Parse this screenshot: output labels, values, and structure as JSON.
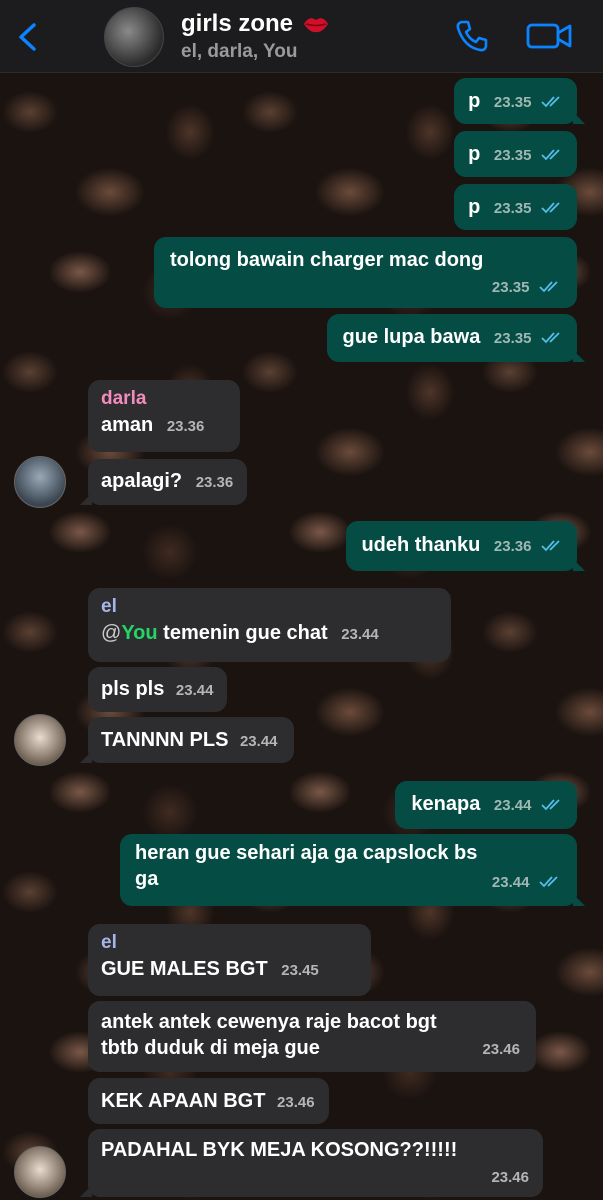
{
  "header": {
    "title": "girls zone",
    "subtitle": "el, darla, You",
    "icons": {
      "back": "chevron-left-icon",
      "lips": "lips-emoji-icon",
      "call": "phone-icon",
      "video": "video-camera-icon"
    },
    "accent_color": "#0a84ff"
  },
  "colors": {
    "outgoing": "#054d44",
    "incoming": "#2d2d2f",
    "darla_name": "#f38bbd",
    "el_name": "#a9b4e6",
    "mention": "#25d366",
    "read_ticks": "#53bdeb"
  },
  "messages": [
    {
      "text": "p",
      "time": "23.35"
    },
    {
      "text": "p",
      "time": "23.35"
    },
    {
      "text": "p",
      "time": "23.35"
    },
    {
      "text": "tolong bawain charger mac dong",
      "time": "23.35"
    },
    {
      "text": "gue lupa bawa",
      "time": "23.35"
    },
    {
      "sender": "darla",
      "text": "aman",
      "time": "23.36"
    },
    {
      "text": "apalagi?",
      "time": "23.36"
    },
    {
      "text": "udeh thanku",
      "time": "23.36"
    },
    {
      "sender": "el",
      "mention_at": "@",
      "mention": "You",
      "text": " temenin gue chat",
      "time": "23.44"
    },
    {
      "text": "pls pls",
      "time": "23.44"
    },
    {
      "text": "TANNNN PLS",
      "time": "23.44"
    },
    {
      "text": "kenapa",
      "time": "23.44"
    },
    {
      "text_line1": "heran gue sehari aja ga capslock bs",
      "text_line2": "ga",
      "time": "23.44"
    },
    {
      "sender": "el",
      "text": "GUE MALES BGT",
      "time": "23.45"
    },
    {
      "text_line1": "antek antek cewenya raje bacot bgt",
      "text_line2": "tbtb duduk di meja gue",
      "time": "23.46"
    },
    {
      "text": "KEK APAAN BGT",
      "time": "23.46"
    },
    {
      "text": "PADAHAL BYK MEJA KOSONG??!!!!!",
      "time": "23.46"
    }
  ]
}
